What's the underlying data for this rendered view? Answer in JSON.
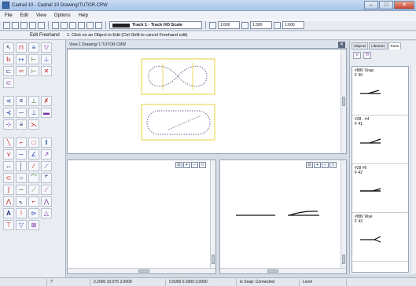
{
  "window": {
    "title": "Cadrail 10 - Cadrail 10 Drawing\\TUTOR.CRW"
  },
  "menu": [
    "File",
    "Edit",
    "View",
    "Options",
    "Help"
  ],
  "toolbar": {
    "track_label": "Track 1 - Track HO Scale",
    "scale_a": "1:000",
    "scale_b": "1:300",
    "scale_c": "1:000"
  },
  "status_row": {
    "mode": "Edit Freehand",
    "hint": "1. Click on an Object to Edit (Ctrl-Shift to cancel Freehand edit)"
  },
  "document": {
    "tab_label": "View 1 Drawing/ 1:TUTOR.CRW"
  },
  "right_panel": {
    "tabs": [
      "Objects",
      "Libraries",
      "Parts"
    ],
    "active_tab": "Parts",
    "items": [
      {
        "name": "#880 Snap",
        "code": "F 40"
      },
      {
        "name": "#28 - #4",
        "code": "F 41"
      },
      {
        "name": "#28 #6",
        "code": "F 42"
      },
      {
        "name": "#880 Wye",
        "code": "F 43"
      }
    ]
  },
  "statusbar": {
    "cell1": "",
    "cell2": "?",
    "coords1": "2.2000 10.075 3.0000",
    "coords2": "0.5000 0.2000 3.0000",
    "snap": "Is Snap: Connected",
    "layer": "Level"
  },
  "colors": {
    "layout_box": "#e6d23a",
    "track_dots": "#8a7fa3"
  }
}
